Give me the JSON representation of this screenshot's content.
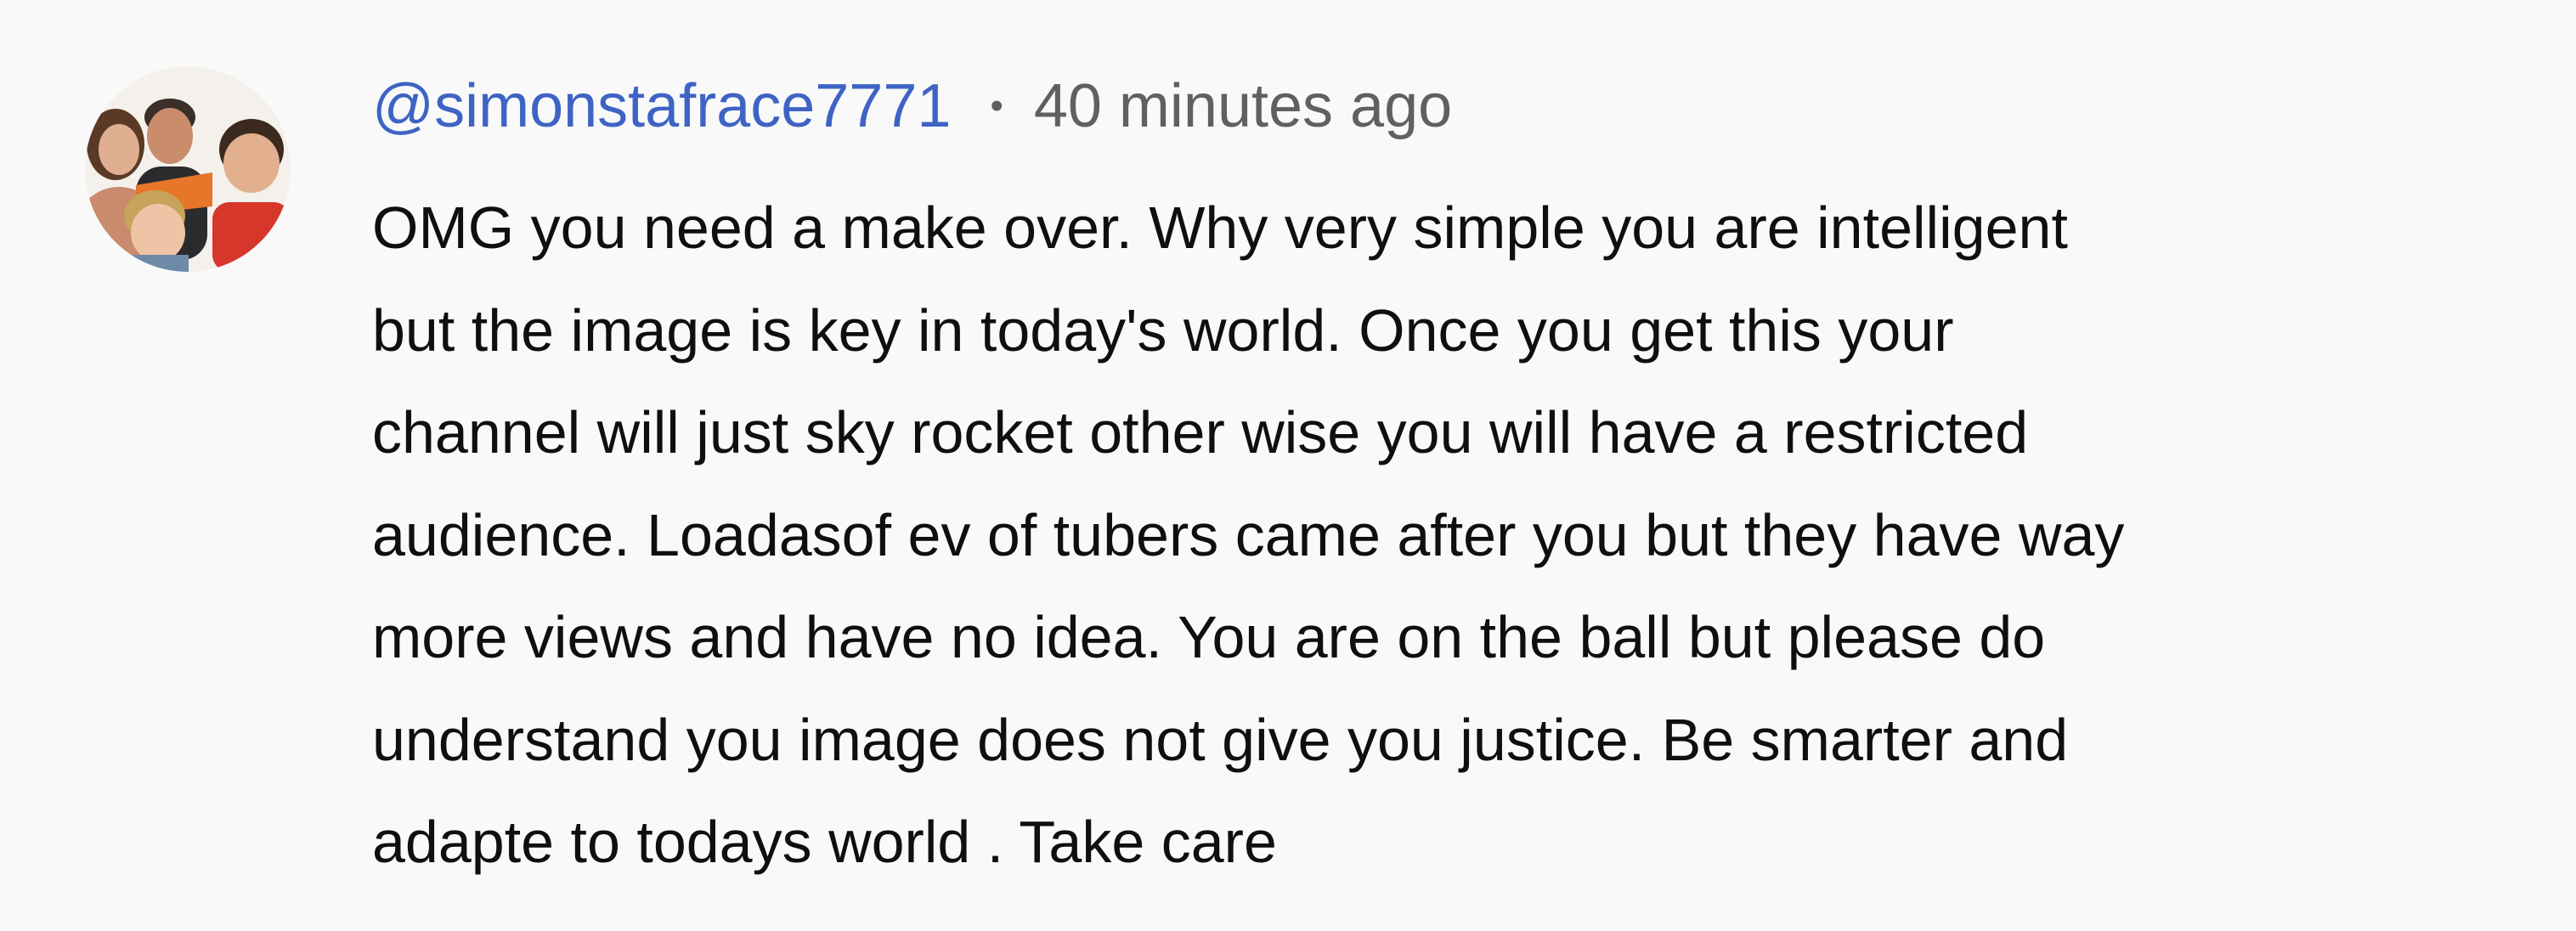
{
  "comment": {
    "author": "@simonstafrace7771",
    "separator": "•",
    "timestamp": "40 minutes ago",
    "text_lines": [
      "OMG you need a make over. Why very simple you are intelligent",
      "but the image is key in today's world. Once you get this your",
      "channel will just sky rocket other wise you will have a restricted",
      "audience. Loadasof ev of tubers came after you but they have way",
      "more views and have no idea. You are on the ball but please do",
      "understand you image does not give you justice. Be smarter and",
      "adapte to todays world . Take care"
    ]
  },
  "colors": {
    "background": "#f9f9f9",
    "author": "#3e63c4",
    "meta": "#606060",
    "text": "#0f0f0f"
  }
}
